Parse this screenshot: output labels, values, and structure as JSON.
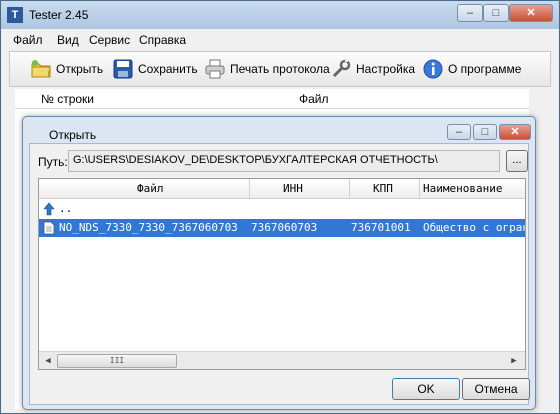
{
  "window": {
    "title": "Tester 2.45",
    "icon_letter": "T"
  },
  "menu": [
    "Файл",
    "Вид",
    "Сервис",
    "Справка"
  ],
  "toolbar": {
    "open_label": "Открыть",
    "save_label": "Сохранить",
    "print_label": "Печать протокола",
    "settings_label": "Настройка",
    "about_label": "О программе"
  },
  "main_list": {
    "col_row": "№ строки",
    "col_file": "Файл"
  },
  "dialog": {
    "title": "Открыть",
    "path_label": "Путь:",
    "path_value": "G:\\USERS\\DESIAKOV_DE\\DESKTOP\\БУХГАЛТЕРСКАЯ ОТЧЕТНОСТЬ\\",
    "browse_label": "...",
    "columns": [
      "Файл",
      "ИНН",
      "КПП",
      "Наименование"
    ],
    "rows": [
      {
        "file": "..",
        "inn": "",
        "kpp": "",
        "name": "",
        "icon": "up-arrow-icon"
      },
      {
        "file": "NO_NDS_7330_7330_7367060703",
        "inn": "7367060703",
        "kpp": "736701001",
        "name": "Общество с ограниченной",
        "icon": "document-icon",
        "selected": true
      }
    ],
    "scroll_thumb": "III",
    "ok_label": "OK",
    "cancel_label": "Отмена"
  },
  "colors": {
    "selection": "#3377d6",
    "dialog_frame": "#dbe6f2"
  }
}
